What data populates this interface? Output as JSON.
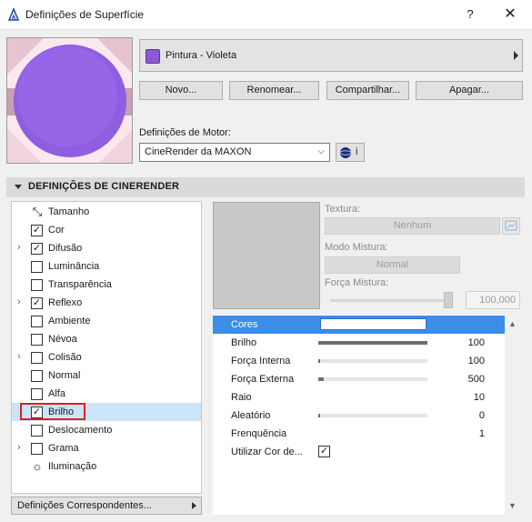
{
  "window": {
    "title": "Definições de Superfície",
    "help": "?",
    "close": "✕"
  },
  "surface": {
    "name": "Pintura - Violeta",
    "color": "#8b5ad3"
  },
  "buttons": {
    "novo": "Novo...",
    "renomear": "Renomear...",
    "compartilhar": "Compartilhar...",
    "apagar": "Apagar..."
  },
  "engine": {
    "label": "Definições de Motor:",
    "value": "CineRender da MAXON",
    "info": "i"
  },
  "section": {
    "title": "DEFINIÇÕES DE CINERENDER"
  },
  "channels": [
    {
      "label": "Tamanho",
      "kind": "icon",
      "icon": "resize-icon",
      "expand": false,
      "checked": false
    },
    {
      "label": "Cor",
      "kind": "check",
      "expand": false,
      "checked": true
    },
    {
      "label": "Difusão",
      "kind": "check",
      "expand": true,
      "checked": true
    },
    {
      "label": "Luminância",
      "kind": "check",
      "expand": false,
      "checked": false
    },
    {
      "label": "Transparência",
      "kind": "check",
      "expand": false,
      "checked": false
    },
    {
      "label": "Reflexo",
      "kind": "check",
      "expand": true,
      "checked": true
    },
    {
      "label": "Ambiente",
      "kind": "check",
      "expand": false,
      "checked": false
    },
    {
      "label": "Névoa",
      "kind": "check",
      "expand": false,
      "checked": false
    },
    {
      "label": "Colisão",
      "kind": "check",
      "expand": true,
      "checked": false
    },
    {
      "label": "Normal",
      "kind": "check",
      "expand": false,
      "checked": false
    },
    {
      "label": "Alfa",
      "kind": "check",
      "expand": false,
      "checked": false
    },
    {
      "label": "Brilho",
      "kind": "check",
      "expand": false,
      "checked": true,
      "selected": true
    },
    {
      "label": "Deslocamento",
      "kind": "check",
      "expand": false,
      "checked": false
    },
    {
      "label": "Grama",
      "kind": "check",
      "expand": true,
      "checked": false
    },
    {
      "label": "Iluminação",
      "kind": "icon",
      "icon": "illumination-icon",
      "expand": false,
      "checked": false
    }
  ],
  "matching": {
    "label": "Definições Correspondentes..."
  },
  "texture": {
    "label": "Textura:",
    "value": "Nenhum",
    "mix_mode_label": "Modo Mistura:",
    "mix_mode_value": "Normal",
    "mix_strength_label": "Força Mistura:",
    "mix_strength_value": "100,000",
    "mix_strength_fraction": 1.0
  },
  "params": [
    {
      "name": "Cores",
      "type": "color",
      "color": "#ffffff",
      "selected": true
    },
    {
      "name": "Brilho",
      "type": "slider",
      "value": "100",
      "fraction": 1.0
    },
    {
      "name": "Força Interna",
      "type": "slider",
      "value": "100",
      "fraction": 0.01
    },
    {
      "name": "Força Externa",
      "type": "slider",
      "value": "500",
      "fraction": 0.05
    },
    {
      "name": "Raio",
      "type": "value",
      "value": "10"
    },
    {
      "name": "Aleatório",
      "type": "slider",
      "value": "0",
      "fraction": 0.01
    },
    {
      "name": "Frenquência",
      "type": "value",
      "value": "1"
    },
    {
      "name": "Utilizar Cor de...",
      "type": "checkbox",
      "checked": true
    }
  ]
}
